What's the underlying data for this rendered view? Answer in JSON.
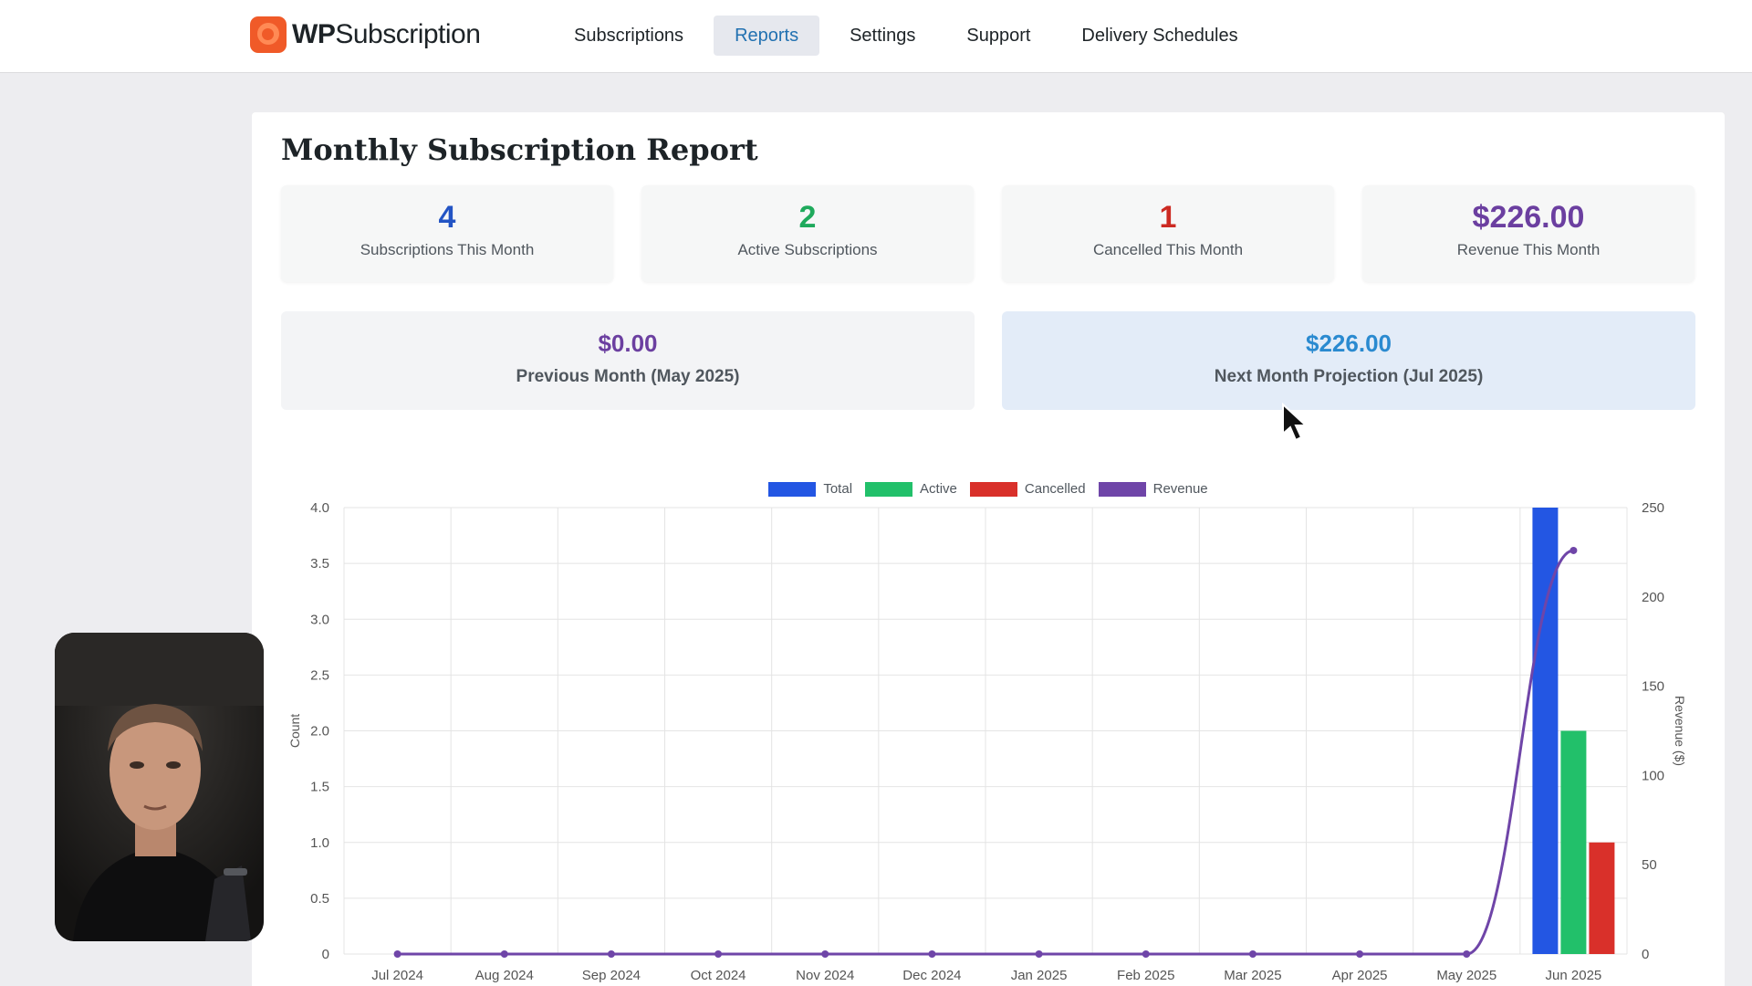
{
  "brand": {
    "name_bold": "WP",
    "name_rest": "Subscription"
  },
  "nav": [
    {
      "label": "Subscriptions"
    },
    {
      "label": "Reports"
    },
    {
      "label": "Settings"
    },
    {
      "label": "Support"
    },
    {
      "label": "Delivery Schedules"
    }
  ],
  "report": {
    "title": "Monthly Subscription Report",
    "stats": [
      {
        "value": "4",
        "label": "Subscriptions This Month",
        "color": "#2354c4"
      },
      {
        "value": "2",
        "label": "Active Subscriptions",
        "color": "#1faa5c"
      },
      {
        "value": "1",
        "label": "Cancelled This Month",
        "color": "#cc2a22"
      },
      {
        "value": "$226.00",
        "label": "Revenue This Month",
        "color": "#6b3fa0"
      }
    ],
    "previous": {
      "value": "$0.00",
      "label": "Previous Month (May 2025)",
      "color": "#6b3fa0"
    },
    "projection": {
      "value": "$226.00",
      "label": "Next Month Projection (Jul 2025)",
      "color": "#2a8ad0"
    }
  },
  "chart_data": {
    "type": "bar",
    "categories": [
      "Jul 2024",
      "Aug 2024",
      "Sep 2024",
      "Oct 2024",
      "Nov 2024",
      "Dec 2024",
      "Jan 2025",
      "Feb 2025",
      "Mar 2025",
      "Apr 2025",
      "May 2025",
      "Jun 2025"
    ],
    "series": [
      {
        "name": "Total",
        "type": "bar",
        "color": "#2356e3",
        "axis": "left",
        "values": [
          0,
          0,
          0,
          0,
          0,
          0,
          0,
          0,
          0,
          0,
          0,
          4
        ]
      },
      {
        "name": "Active",
        "type": "bar",
        "color": "#22c06a",
        "axis": "left",
        "values": [
          0,
          0,
          0,
          0,
          0,
          0,
          0,
          0,
          0,
          0,
          0,
          2
        ]
      },
      {
        "name": "Cancelled",
        "type": "bar",
        "color": "#d9302a",
        "axis": "left",
        "values": [
          0,
          0,
          0,
          0,
          0,
          0,
          0,
          0,
          0,
          0,
          0,
          1
        ]
      },
      {
        "name": "Revenue",
        "type": "line",
        "color": "#6f45a8",
        "axis": "right",
        "values": [
          0,
          0,
          0,
          0,
          0,
          0,
          0,
          0,
          0,
          0,
          0,
          226
        ]
      }
    ],
    "ylabel": "Count",
    "y2label": "Revenue ($)",
    "ylim": [
      0,
      4
    ],
    "y2lim": [
      0,
      250
    ],
    "yticks": [
      "0",
      "0.5",
      "1.0",
      "1.5",
      "2.0",
      "2.5",
      "3.0",
      "3.5",
      "4.0"
    ],
    "y2ticks": [
      "0",
      "50",
      "100",
      "150",
      "200",
      "250"
    ],
    "grid": true,
    "legend_position": "top-center"
  }
}
